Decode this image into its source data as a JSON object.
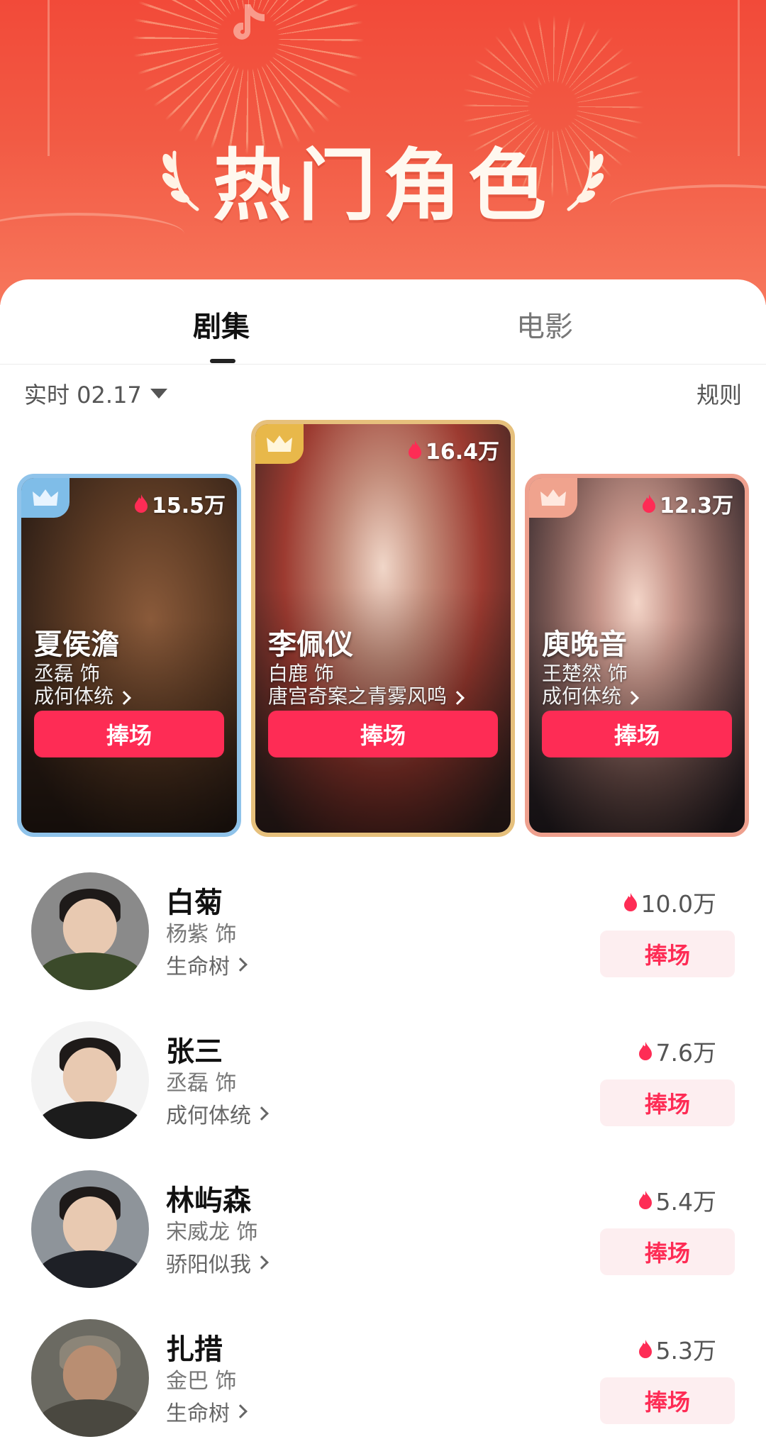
{
  "header": {
    "title": "热门角色"
  },
  "tabs": [
    {
      "label": "剧集",
      "active": true
    },
    {
      "label": "电影",
      "active": false
    }
  ],
  "filter": {
    "label": "实时 02.17"
  },
  "rules_label": "规则",
  "colors": {
    "brand": "#fe2c55",
    "rank1": "#e8b84a",
    "rank2": "#7fbde8",
    "rank3": "#f0a38e"
  },
  "top3": [
    {
      "rank": 2,
      "heat": "15.5万",
      "name": "夏侯澹",
      "actor": "丞磊 饰",
      "show": "成何体统",
      "button": "捧场"
    },
    {
      "rank": 1,
      "heat": "16.4万",
      "name": "李佩仪",
      "actor": "白鹿 饰",
      "show": "唐宫奇案之青雾风鸣",
      "button": "捧场"
    },
    {
      "rank": 3,
      "heat": "12.3万",
      "name": "庾晚音",
      "actor": "王楚然 饰",
      "show": "成何体统",
      "button": "捧场"
    }
  ],
  "list": [
    {
      "name": "白菊",
      "actor": "杨紫 饰",
      "show": "生命树",
      "heat": "10.0万",
      "button": "捧场"
    },
    {
      "name": "张三",
      "actor": "丞磊 饰",
      "show": "成何体统",
      "heat": "7.6万",
      "button": "捧场"
    },
    {
      "name": "林屿森",
      "actor": "宋威龙 饰",
      "show": "骄阳似我",
      "heat": "5.4万",
      "button": "捧场"
    },
    {
      "name": "扎措",
      "actor": "金巴 饰",
      "show": "生命树",
      "heat": "5.3万",
      "button": "捧场"
    }
  ]
}
